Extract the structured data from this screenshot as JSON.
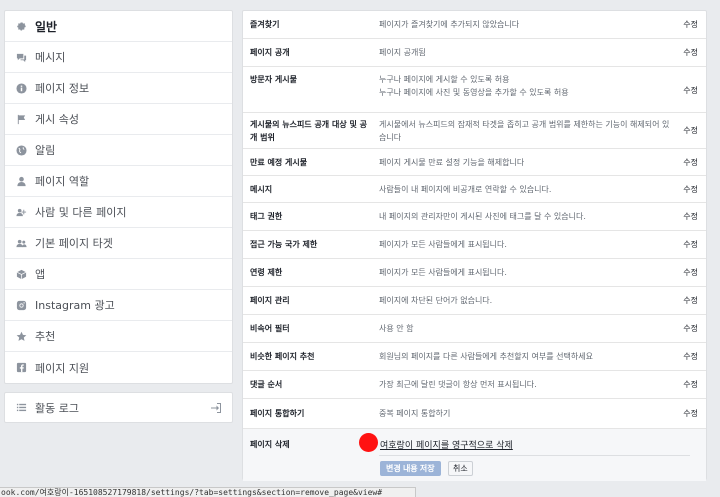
{
  "sidebar": {
    "items": [
      {
        "label": "일반",
        "icon": "gear-icon"
      },
      {
        "label": "메시지",
        "icon": "chat-icon"
      },
      {
        "label": "페이지 정보",
        "icon": "info-icon"
      },
      {
        "label": "게시 속성",
        "icon": "flag-icon"
      },
      {
        "label": "알림",
        "icon": "globe-icon"
      },
      {
        "label": "페이지 역할",
        "icon": "person-icon"
      },
      {
        "label": "사람 및 다른 페이지",
        "icon": "people-icon"
      },
      {
        "label": "기본 페이지 타겟",
        "icon": "people-target-icon"
      },
      {
        "label": "앱",
        "icon": "cube-icon"
      },
      {
        "label": "Instagram 광고",
        "icon": "instagram-icon"
      },
      {
        "label": "추천",
        "icon": "star-icon"
      },
      {
        "label": "페이지 지원",
        "icon": "facebook-icon"
      }
    ],
    "activity_log": {
      "label": "활동 로그",
      "icon": "list-icon"
    }
  },
  "settings": {
    "edit_label": "수정",
    "rows": [
      {
        "label": "즐겨찾기",
        "desc": "페이지가 즐겨찾기에 추가되지 않았습니다"
      },
      {
        "label": "페이지 공개",
        "desc": "페이지 공개됨"
      },
      {
        "label": "방문자 게시물",
        "desc": "누구나 페이지에 게시할 수 있도록 허용\n누구나 페이지에 사진 및 동영상을 추가할 수 있도록 허용"
      },
      {
        "label": "게시물의 뉴스피드 공개 대상 및 공개 범위",
        "desc": "게시물에서 뉴스피드의 잠재적 타겟을 좁히고 공개 범위를 제한하는 기능이 해제되어 있습니다"
      },
      {
        "label": "만료 예정 게시물",
        "desc": "페이지 게시물 만료 설정 기능을 해제합니다"
      },
      {
        "label": "메시지",
        "desc": "사람들이 내 페이지에 비공개로 연락할 수 있습니다."
      },
      {
        "label": "태그 권한",
        "desc": "내 페이지의 관리자만이 게시된 사진에 태그를 달 수 있습니다."
      },
      {
        "label": "접근 가능 국가 제한",
        "desc": "페이지가 모든 사람들에게 표시됩니다."
      },
      {
        "label": "연령 제한",
        "desc": "페이지가 모든 사람들에게 표시됩니다."
      },
      {
        "label": "페이지 관리",
        "desc": "페이지에 차단된 단어가 없습니다."
      },
      {
        "label": "비속어 필터",
        "desc": "사용 안 함"
      },
      {
        "label": "비슷한 페이지 추천",
        "desc": "회원님의 페이지를 다른 사람들에게 추천할지 여부를 선택하세요"
      },
      {
        "label": "댓글 순서",
        "desc": "가장 최근에 달린 댓글이 항상 먼저 표시됩니다."
      },
      {
        "label": "페이지 통합하기",
        "desc": "중복 페이지 통합하기"
      }
    ],
    "delete": {
      "label": "페이지 삭제",
      "link": "여호랑이 페이지를 영구적으로 삭제",
      "save_label": "변경 내용 저장",
      "cancel_label": "취소"
    }
  },
  "statusbar": {
    "url": "ook.com/여호랑이-165108527179818/settings/?tab=settings&section=remove_page&view#"
  },
  "colors": {
    "background": "#e9ebee",
    "highlight": "#ff1212",
    "save_button": "#9cb4d8"
  }
}
